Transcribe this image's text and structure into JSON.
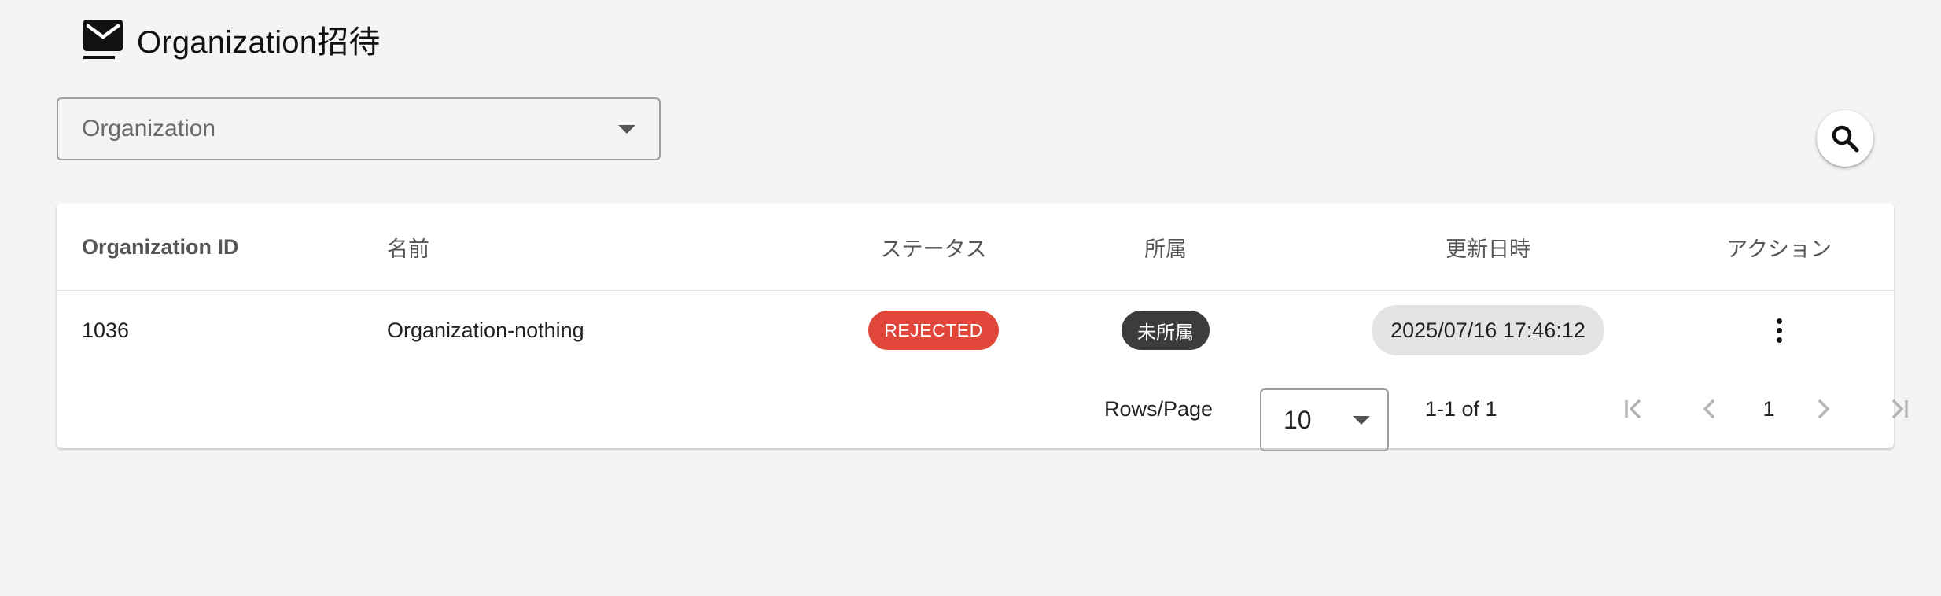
{
  "header": {
    "title": "Organization招待",
    "icon": "mail-icon"
  },
  "filter": {
    "placeholder": "Organization",
    "icon": "chevron-down-icon"
  },
  "search": {
    "icon": "search-icon"
  },
  "table": {
    "columns": [
      "Organization ID",
      "名前",
      "ステータス",
      "所属",
      "更新日時",
      "アクション"
    ],
    "rows": [
      {
        "organization_id": "1036",
        "name": "Organization-nothing",
        "status": "REJECTED",
        "affiliation": "未所属",
        "updated_at": "2025/07/16 17:46:12",
        "action_icon": "more-vert-icon"
      }
    ]
  },
  "pagination": {
    "rows_per_page_label": "Rows/Page",
    "rows_per_page_value": "10",
    "range_text": "1-1 of 1",
    "current_page": "1",
    "icons": [
      "first-page-icon",
      "prev-page-icon",
      "next-page-icon",
      "last-page-icon"
    ]
  },
  "colors": {
    "background": "#f4f4f4",
    "status_rejected": "#e0473a",
    "affiliation_chip": "#3c3c3c",
    "date_chip": "#e4e4e4"
  }
}
